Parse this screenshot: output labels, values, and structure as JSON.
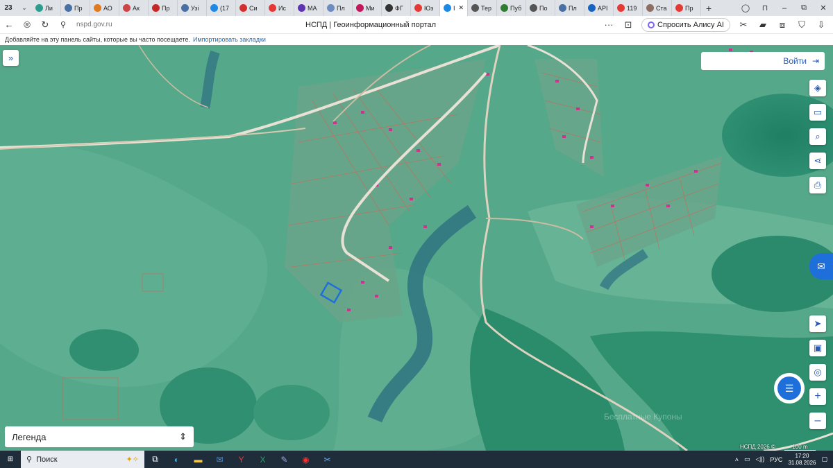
{
  "tabs": {
    "count": "23",
    "items": [
      {
        "label": "Ли",
        "color": "#2a9d8f"
      },
      {
        "label": "Пр",
        "color": "#4a6fa5"
      },
      {
        "label": "АО",
        "color": "#e07a1f"
      },
      {
        "label": "Ак",
        "color": "#c44"
      },
      {
        "label": "Пр",
        "color": "#c62828"
      },
      {
        "label": "Узі",
        "color": "#4a6fa5"
      },
      {
        "label": "(17",
        "color": "#1e88e5"
      },
      {
        "label": "Си",
        "color": "#d32f2f"
      },
      {
        "label": "Ис",
        "color": "#e53935"
      },
      {
        "label": "МА",
        "color": "#5e35b1"
      },
      {
        "label": "Пл",
        "color": "#6d8cc0"
      },
      {
        "label": "Ми",
        "color": "#c2185b"
      },
      {
        "label": "ФГ",
        "color": "#333"
      },
      {
        "label": "Юз",
        "color": "#e53935"
      },
      {
        "label": "I",
        "color": "#1e88e5",
        "active": true
      },
      {
        "label": "Тер",
        "color": "#555"
      },
      {
        "label": "Пуб",
        "color": "#2e7d32"
      },
      {
        "label": "По",
        "color": "#555"
      },
      {
        "label": "Пл",
        "color": "#4a6fa5"
      },
      {
        "label": "АРІ",
        "color": "#1565c0"
      },
      {
        "label": "119",
        "color": "#e53935"
      },
      {
        "label": "Ста",
        "color": "#8d6e63"
      },
      {
        "label": "Пр",
        "color": "#e53935"
      }
    ]
  },
  "address": {
    "url": "nspd.gov.ru",
    "title": "НСПД | Геоинформационный портал",
    "alisa": "Спросить Алису AI"
  },
  "bookmarks": {
    "hint": "Добавляйте на эту панель сайты, которые вы часто посещаете.",
    "import_link": "Импортировать закладки"
  },
  "map": {
    "login_label": "Войти",
    "legend_label": "Легенда",
    "copyright": "НСПД 2026 ©",
    "scale": "100 m",
    "watermark": "Бесплатные Купоны"
  },
  "taskbar": {
    "search_label": "Поиск",
    "lang": "РУС",
    "time": "17:20",
    "date": "31.08.2026"
  }
}
